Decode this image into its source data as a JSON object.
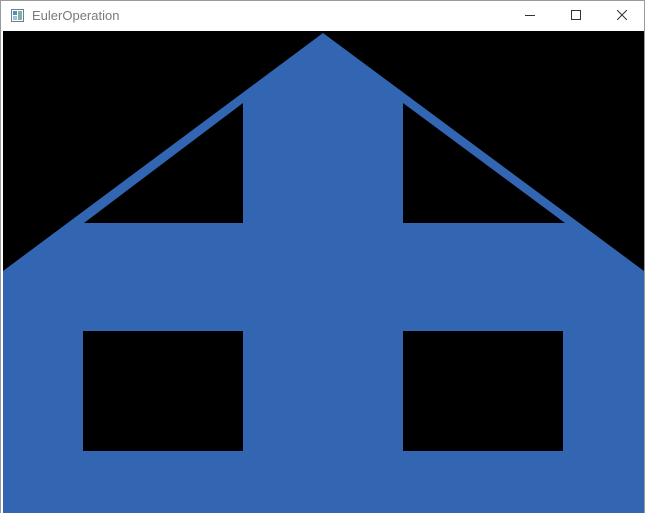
{
  "window": {
    "title": "EulerOperation",
    "app_icon": "app-window-icon",
    "controls": {
      "minimize_icon": "minimize-icon",
      "maximize_icon": "maximize-icon",
      "close_icon": "close-icon"
    }
  },
  "canvas": {
    "background_color": "#000000",
    "shape_color": "#3366b2",
    "shape": "house-solid-with-four-holes"
  }
}
